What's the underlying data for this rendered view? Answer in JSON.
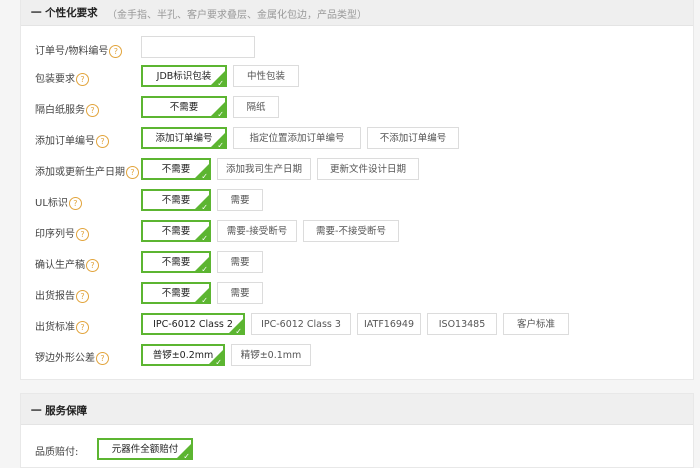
{
  "section1": {
    "title": "一 个性化要求",
    "subtitle": "（金手指、半孔、客户要求叠层、金属化包边，产品类型）"
  },
  "section2": {
    "title": "一 服务保障"
  },
  "help_glyph": "?",
  "check_glyph": "✓",
  "rows": [
    {
      "label": "订单号/物料编号",
      "input_value": ""
    },
    {
      "label": "包装要求",
      "options": [
        "JDB标识包装",
        "中性包装"
      ],
      "selected": 0
    },
    {
      "label": "隔白纸服务",
      "options": [
        "不需要",
        "隔纸"
      ],
      "selected": 0
    },
    {
      "label": "添加订单编号",
      "options": [
        "添加订单编号",
        "指定位置添加订单编号",
        "不添加订单编号"
      ],
      "selected": 0
    },
    {
      "label": "添加或更新生产日期",
      "options": [
        "不需要",
        "添加我司生产日期",
        "更新文件设计日期"
      ],
      "selected": 0
    },
    {
      "label": "UL标识",
      "options": [
        "不需要",
        "需要"
      ],
      "selected": 0
    },
    {
      "label": "印序列号",
      "options": [
        "不需要",
        "需要-接受断号",
        "需要-不接受断号"
      ],
      "selected": 0
    },
    {
      "label": "确认生产稿",
      "options": [
        "不需要",
        "需要"
      ],
      "selected": 0
    },
    {
      "label": "出货报告",
      "options": [
        "不需要",
        "需要"
      ],
      "selected": 0
    },
    {
      "label": "出货标准",
      "options": [
        "IPC-6012 Class 2",
        "IPC-6012 Class 3",
        "IATF16949",
        "ISO13485",
        "客户标准"
      ],
      "selected": 0
    },
    {
      "label": "锣边外形公差",
      "options": [
        "普锣±0.2mm",
        "精锣±0.1mm"
      ],
      "selected": 0
    }
  ],
  "service": {
    "label": "品质赔付:",
    "options": [
      "元器件全额赔付"
    ],
    "selected": 0
  },
  "colors": {
    "accent": "#5cb531",
    "help": "#e2a43c",
    "header_bg": "#efefef"
  }
}
